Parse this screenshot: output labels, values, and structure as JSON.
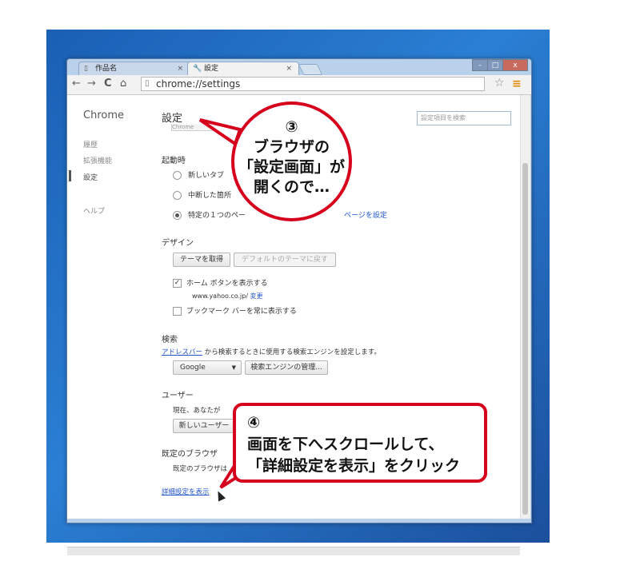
{
  "tabs": [
    {
      "label": "作品名",
      "close": "×"
    },
    {
      "label": "設定",
      "close": "×"
    }
  ],
  "window_controls": {
    "minimize": "–",
    "maximize": "□",
    "close": "x"
  },
  "toolbar": {
    "back": "←",
    "forward": "→",
    "reload": "C",
    "home": "⌂",
    "url": "chrome://settings",
    "star": "☆",
    "menu": "≡"
  },
  "sidebar": {
    "title": "Chrome",
    "items": [
      "履歴",
      "拡張機能",
      "設定",
      "ヘルプ"
    ]
  },
  "settings": {
    "title": "設定",
    "search_placeholder": "設定項目を検索",
    "partial_button": "Chrome",
    "startup": {
      "heading": "起動時",
      "options": [
        "新しいタブ",
        "中断した箇所",
        "特定の１つのペー"
      ],
      "set_pages_link": "ページを設定"
    },
    "design": {
      "heading": "デザイン",
      "get_theme": "テーマを取得",
      "reset_theme": "デフォルトのテーマに戻す",
      "show_home": "ホーム ボタンを表示する",
      "home_url": "www.yahoo.co.jp/",
      "change_link": "変更",
      "bookmark_bar": "ブックマーク バーを常に表示する"
    },
    "search": {
      "heading": "検索",
      "address_bar_link": "アドレスバー",
      "description": " から検索するときに使用する検索エンジンを設定します。",
      "engine": "Google",
      "manage": "検索エンジンの管理..."
    },
    "users": {
      "heading": "ユーザー",
      "current": "現在、あなたが",
      "new_user": "新しいユーザー"
    },
    "default_browser": {
      "heading": "既定のブラウザ",
      "text": "既定のブラウザは"
    },
    "advanced_link": "詳細設定を表示"
  },
  "callout3": {
    "lines": [
      "③",
      "ブラウザの",
      "「設定画面」が",
      "開くので…"
    ]
  },
  "callout4": {
    "lines": [
      "④",
      "画面を下へスクロールして、",
      "「詳細設定を表示」をクリック"
    ]
  },
  "colors": {
    "callout_border": "#d6001c",
    "desktop": "#1a5fb4",
    "link": "#2255cc"
  }
}
